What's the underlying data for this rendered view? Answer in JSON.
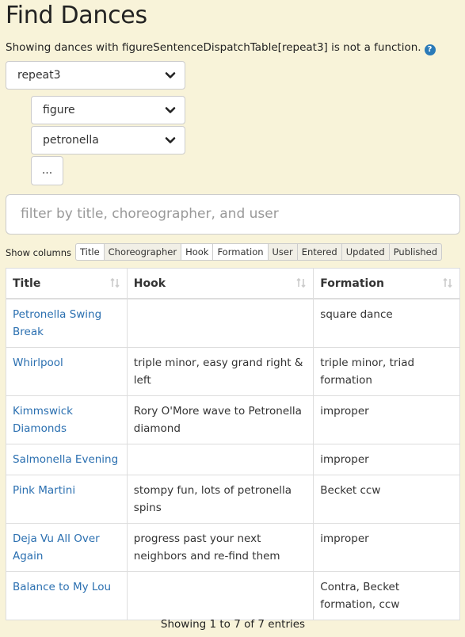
{
  "page": {
    "title": "Find Dances",
    "subtitle": "Showing dances with figureSentenceDispatchTable[repeat3] is not a function.",
    "help_icon": "question-circle-icon"
  },
  "filters": {
    "main_select": "repeat3",
    "sub_select_1": "figure",
    "sub_select_2": "petronella",
    "more_label": "..."
  },
  "search": {
    "placeholder": "filter by title, choreographer, and user"
  },
  "columns_toggle": {
    "label": "Show columns",
    "buttons": [
      {
        "label": "Title",
        "active": true
      },
      {
        "label": "Choreographer",
        "active": false
      },
      {
        "label": "Hook",
        "active": true
      },
      {
        "label": "Formation",
        "active": true
      },
      {
        "label": "User",
        "active": false
      },
      {
        "label": "Entered",
        "active": false
      },
      {
        "label": "Updated",
        "active": false
      },
      {
        "label": "Published",
        "active": false
      }
    ]
  },
  "table": {
    "headers": [
      "Title",
      "Hook",
      "Formation"
    ],
    "rows": [
      {
        "title": "Petronella Swing Break",
        "hook": "",
        "formation": "square dance"
      },
      {
        "title": "Whirlpool",
        "hook": "triple minor, easy grand right & left",
        "formation": "triple minor, triad formation"
      },
      {
        "title": "Kimmswick Diamonds",
        "hook": "Rory O'More wave to Petronella diamond",
        "formation": "improper"
      },
      {
        "title": "Salmonella Evening",
        "hook": "",
        "formation": "improper"
      },
      {
        "title": "Pink Martini",
        "hook": "stompy fun, lots of petronella spins",
        "formation": "Becket ccw"
      },
      {
        "title": "Deja Vu All Over Again",
        "hook": "progress past your next neighbors and re-find them",
        "formation": "improper"
      },
      {
        "title": "Balance to My Lou",
        "hook": "",
        "formation": "Contra, Becket formation, ccw"
      }
    ]
  },
  "info": "Showing 1 to 7 of 7 entries",
  "colors": {
    "background": "#f8f3d9",
    "link": "#2a6fb0",
    "accent": "#2a7ab8"
  }
}
